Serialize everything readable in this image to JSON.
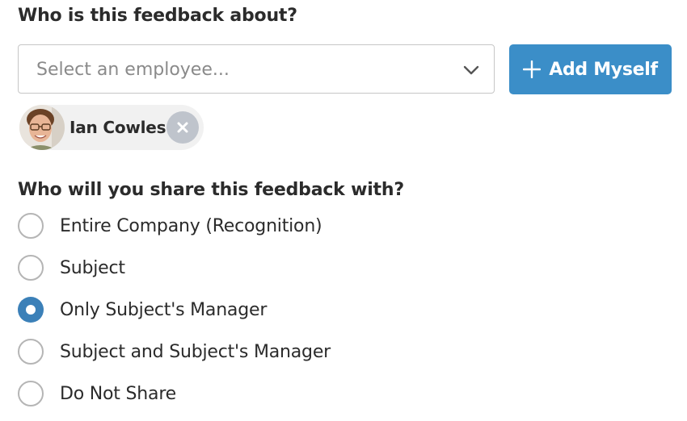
{
  "about_section": {
    "question": "Who is this feedback about?",
    "employee_select": {
      "placeholder": "Select an employee..."
    },
    "add_myself_button": {
      "label": "Add Myself",
      "icon": "plus-icon",
      "color": "#3b8ec8"
    },
    "selected_employees": [
      {
        "name": "Ian Cowles",
        "remove_icon": "close-icon"
      }
    ]
  },
  "share_section": {
    "question": "Who will you share this feedback with?",
    "selected_value": "Only Subject's Manager",
    "options": [
      {
        "label": "Entire Company (Recognition)",
        "checked": false
      },
      {
        "label": "Subject",
        "checked": false
      },
      {
        "label": "Only Subject's Manager",
        "checked": true
      },
      {
        "label": "Subject and Subject's Manager",
        "checked": false
      },
      {
        "label": "Do Not Share",
        "checked": false
      }
    ]
  },
  "colors": {
    "accent": "#3b8ec8",
    "radio_checked": "#3b80b8",
    "chip_background": "#f1f1f1",
    "remove_button": "#bfc4cc"
  }
}
